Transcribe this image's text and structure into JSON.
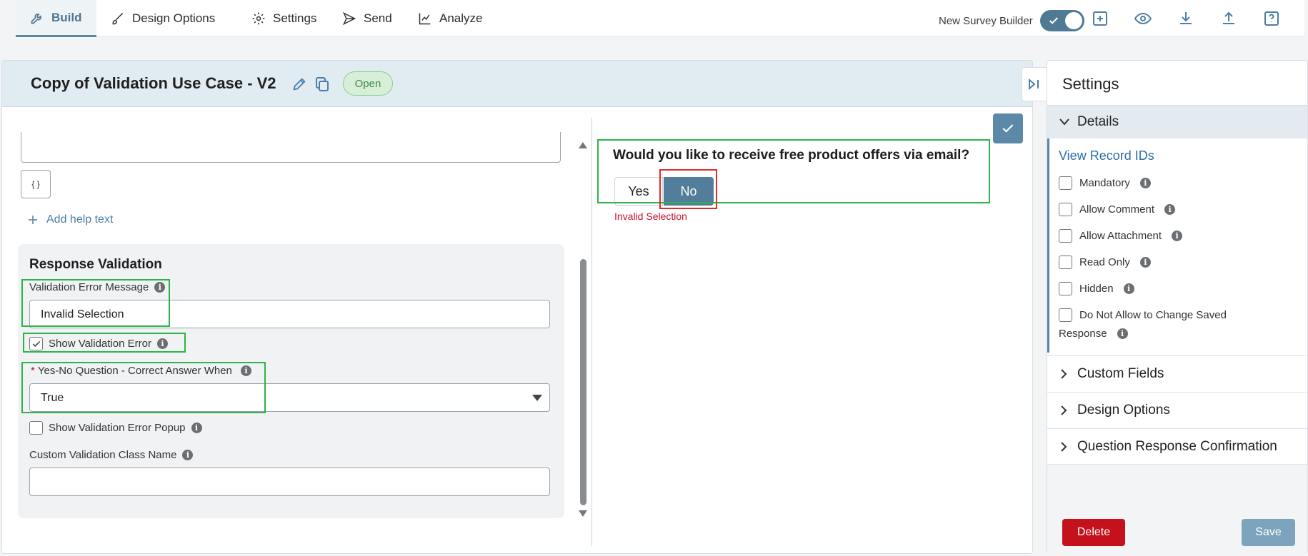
{
  "nav": {
    "tabs": [
      {
        "label": "Build",
        "icon": "wrench-icon"
      },
      {
        "label": "Design Options",
        "icon": "brush-icon"
      },
      {
        "label": "Settings",
        "icon": "gear-icon"
      },
      {
        "label": "Send",
        "icon": "send-icon"
      },
      {
        "label": "Analyze",
        "icon": "chart-icon"
      }
    ],
    "active_tab": "Build",
    "toggle_label": "New Survey Builder",
    "toggle_on": true
  },
  "survey": {
    "title": "Copy of Validation Use Case - V2",
    "status": "Open"
  },
  "editor": {
    "brace_label": "{ }",
    "add_help_text": "Add help text",
    "response_validation": {
      "title": "Response Validation",
      "error_message_label": "Validation Error Message",
      "error_message_value": "Invalid Selection",
      "show_error_label": "Show Validation Error",
      "show_error_checked": true,
      "correct_answer_label": "Yes-No Question - Correct Answer When",
      "correct_answer_required_mark": "*",
      "correct_answer_value": "True",
      "show_popup_label": "Show Validation Error Popup",
      "show_popup_checked": false,
      "custom_class_label": "Custom Validation Class Name",
      "custom_class_value": ""
    }
  },
  "preview": {
    "question": "Would you like to receive free product offers via email?",
    "yes_label": "Yes",
    "no_label": "No",
    "selected": "No",
    "error_text": "Invalid Selection"
  },
  "settings": {
    "title": "Settings",
    "details_label": "Details",
    "view_record_ids": "View Record IDs",
    "options": [
      {
        "label": "Mandatory",
        "checked": false
      },
      {
        "label": "Allow Comment",
        "checked": false
      },
      {
        "label": "Allow Attachment",
        "checked": false
      },
      {
        "label": "Read Only",
        "checked": false
      },
      {
        "label": "Hidden",
        "checked": false
      }
    ],
    "dna_line1": "Do Not Allow to Change Saved",
    "dna_line2": "Response",
    "sections": [
      "Custom Fields",
      "Design Options",
      "Question Response Confirmation"
    ],
    "delete_label": "Delete",
    "save_label": "Save"
  },
  "colors": {
    "accent": "#5a86a3",
    "highlight_green": "#2eb34a",
    "highlight_red": "#e02a2a",
    "error": "#c8102e",
    "delete": "#c5111b"
  }
}
